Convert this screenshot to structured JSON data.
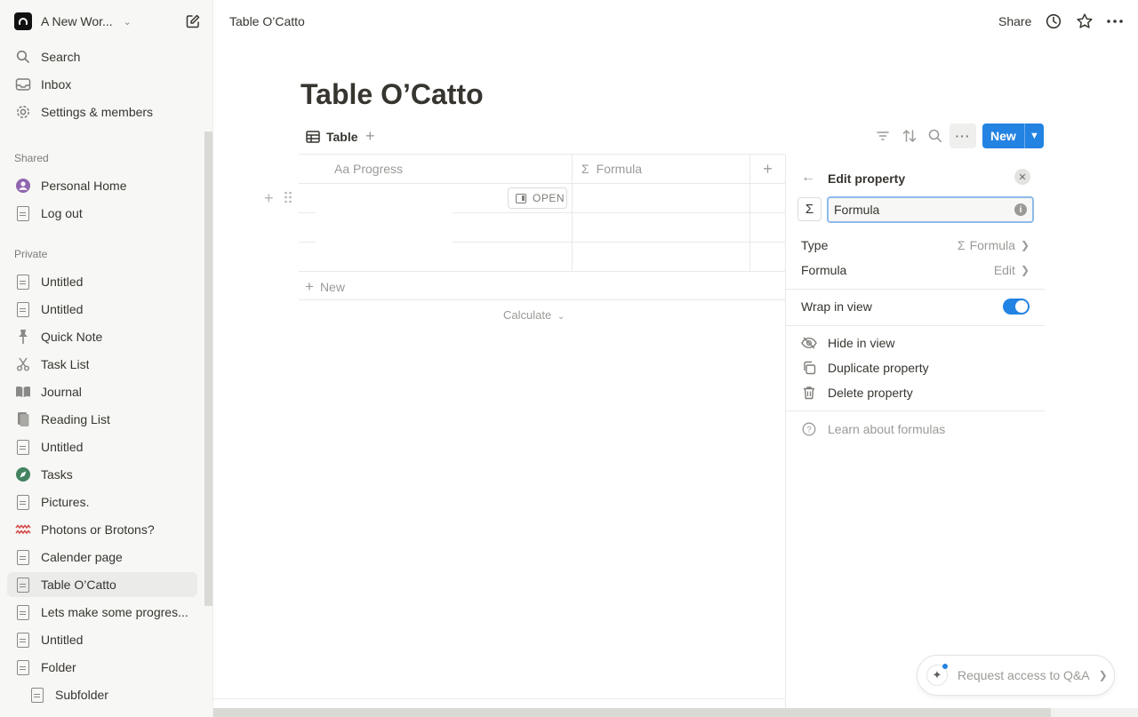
{
  "workspace": {
    "name": "A New Wor..."
  },
  "sidebar": {
    "top_items": [
      {
        "label": "Search",
        "icon": "search-icon"
      },
      {
        "label": "Inbox",
        "icon": "inbox-icon"
      },
      {
        "label": "Settings & members",
        "icon": "gear-icon"
      }
    ],
    "shared_label": "Shared",
    "shared_items": [
      {
        "label": "Personal Home",
        "icon": "user-circle-icon"
      },
      {
        "label": "Log out",
        "icon": "page-icon"
      }
    ],
    "private_label": "Private",
    "private_items": [
      {
        "label": "Untitled",
        "icon": "page-icon"
      },
      {
        "label": "Untitled",
        "icon": "page-icon"
      },
      {
        "label": "Quick Note",
        "icon": "pin-icon"
      },
      {
        "label": "Task List",
        "icon": "scissors-icon"
      },
      {
        "label": "Journal",
        "icon": "book-icon"
      },
      {
        "label": "Reading List",
        "icon": "books-icon"
      },
      {
        "label": "Untitled",
        "icon": "page-icon"
      },
      {
        "label": "Tasks",
        "icon": "compass-icon"
      },
      {
        "label": "Pictures.",
        "icon": "page-icon"
      },
      {
        "label": "Photons or Brotons?",
        "icon": "wave-icon"
      },
      {
        "label": "Calender page",
        "icon": "page-icon"
      },
      {
        "label": "Table O’Catto",
        "icon": "page-icon"
      },
      {
        "label": "Lets make some progres...",
        "icon": "page-icon"
      },
      {
        "label": "Untitled",
        "icon": "page-icon"
      },
      {
        "label": "Folder",
        "icon": "page-icon"
      },
      {
        "label": "Subfolder",
        "icon": "page-icon"
      }
    ]
  },
  "topbar": {
    "breadcrumb": "Table O’Catto",
    "share_label": "Share"
  },
  "page": {
    "title": "Table O’Catto",
    "view_tab": "Table",
    "new_button": "New",
    "columns": [
      "Aa Progress",
      "Formula"
    ],
    "open_label": "OPEN",
    "new_row_label": "New",
    "calculate_label": "Calculate"
  },
  "panel": {
    "title": "Edit property",
    "name_value": "Formula",
    "type_label": "Type",
    "type_value": "Formula",
    "formula_label": "Formula",
    "formula_value": "Edit",
    "wrap_label": "Wrap in view",
    "wrap_on": true,
    "hide_label": "Hide in view",
    "duplicate_label": "Duplicate property",
    "delete_label": "Delete property",
    "learn_label": "Learn about formulas"
  },
  "qa": {
    "label": "Request access to Q&A"
  },
  "colors": {
    "accent": "#2383e2",
    "sidebar_bg": "#f7f7f5",
    "text": "#37352f",
    "muted": "#9b9a97"
  }
}
